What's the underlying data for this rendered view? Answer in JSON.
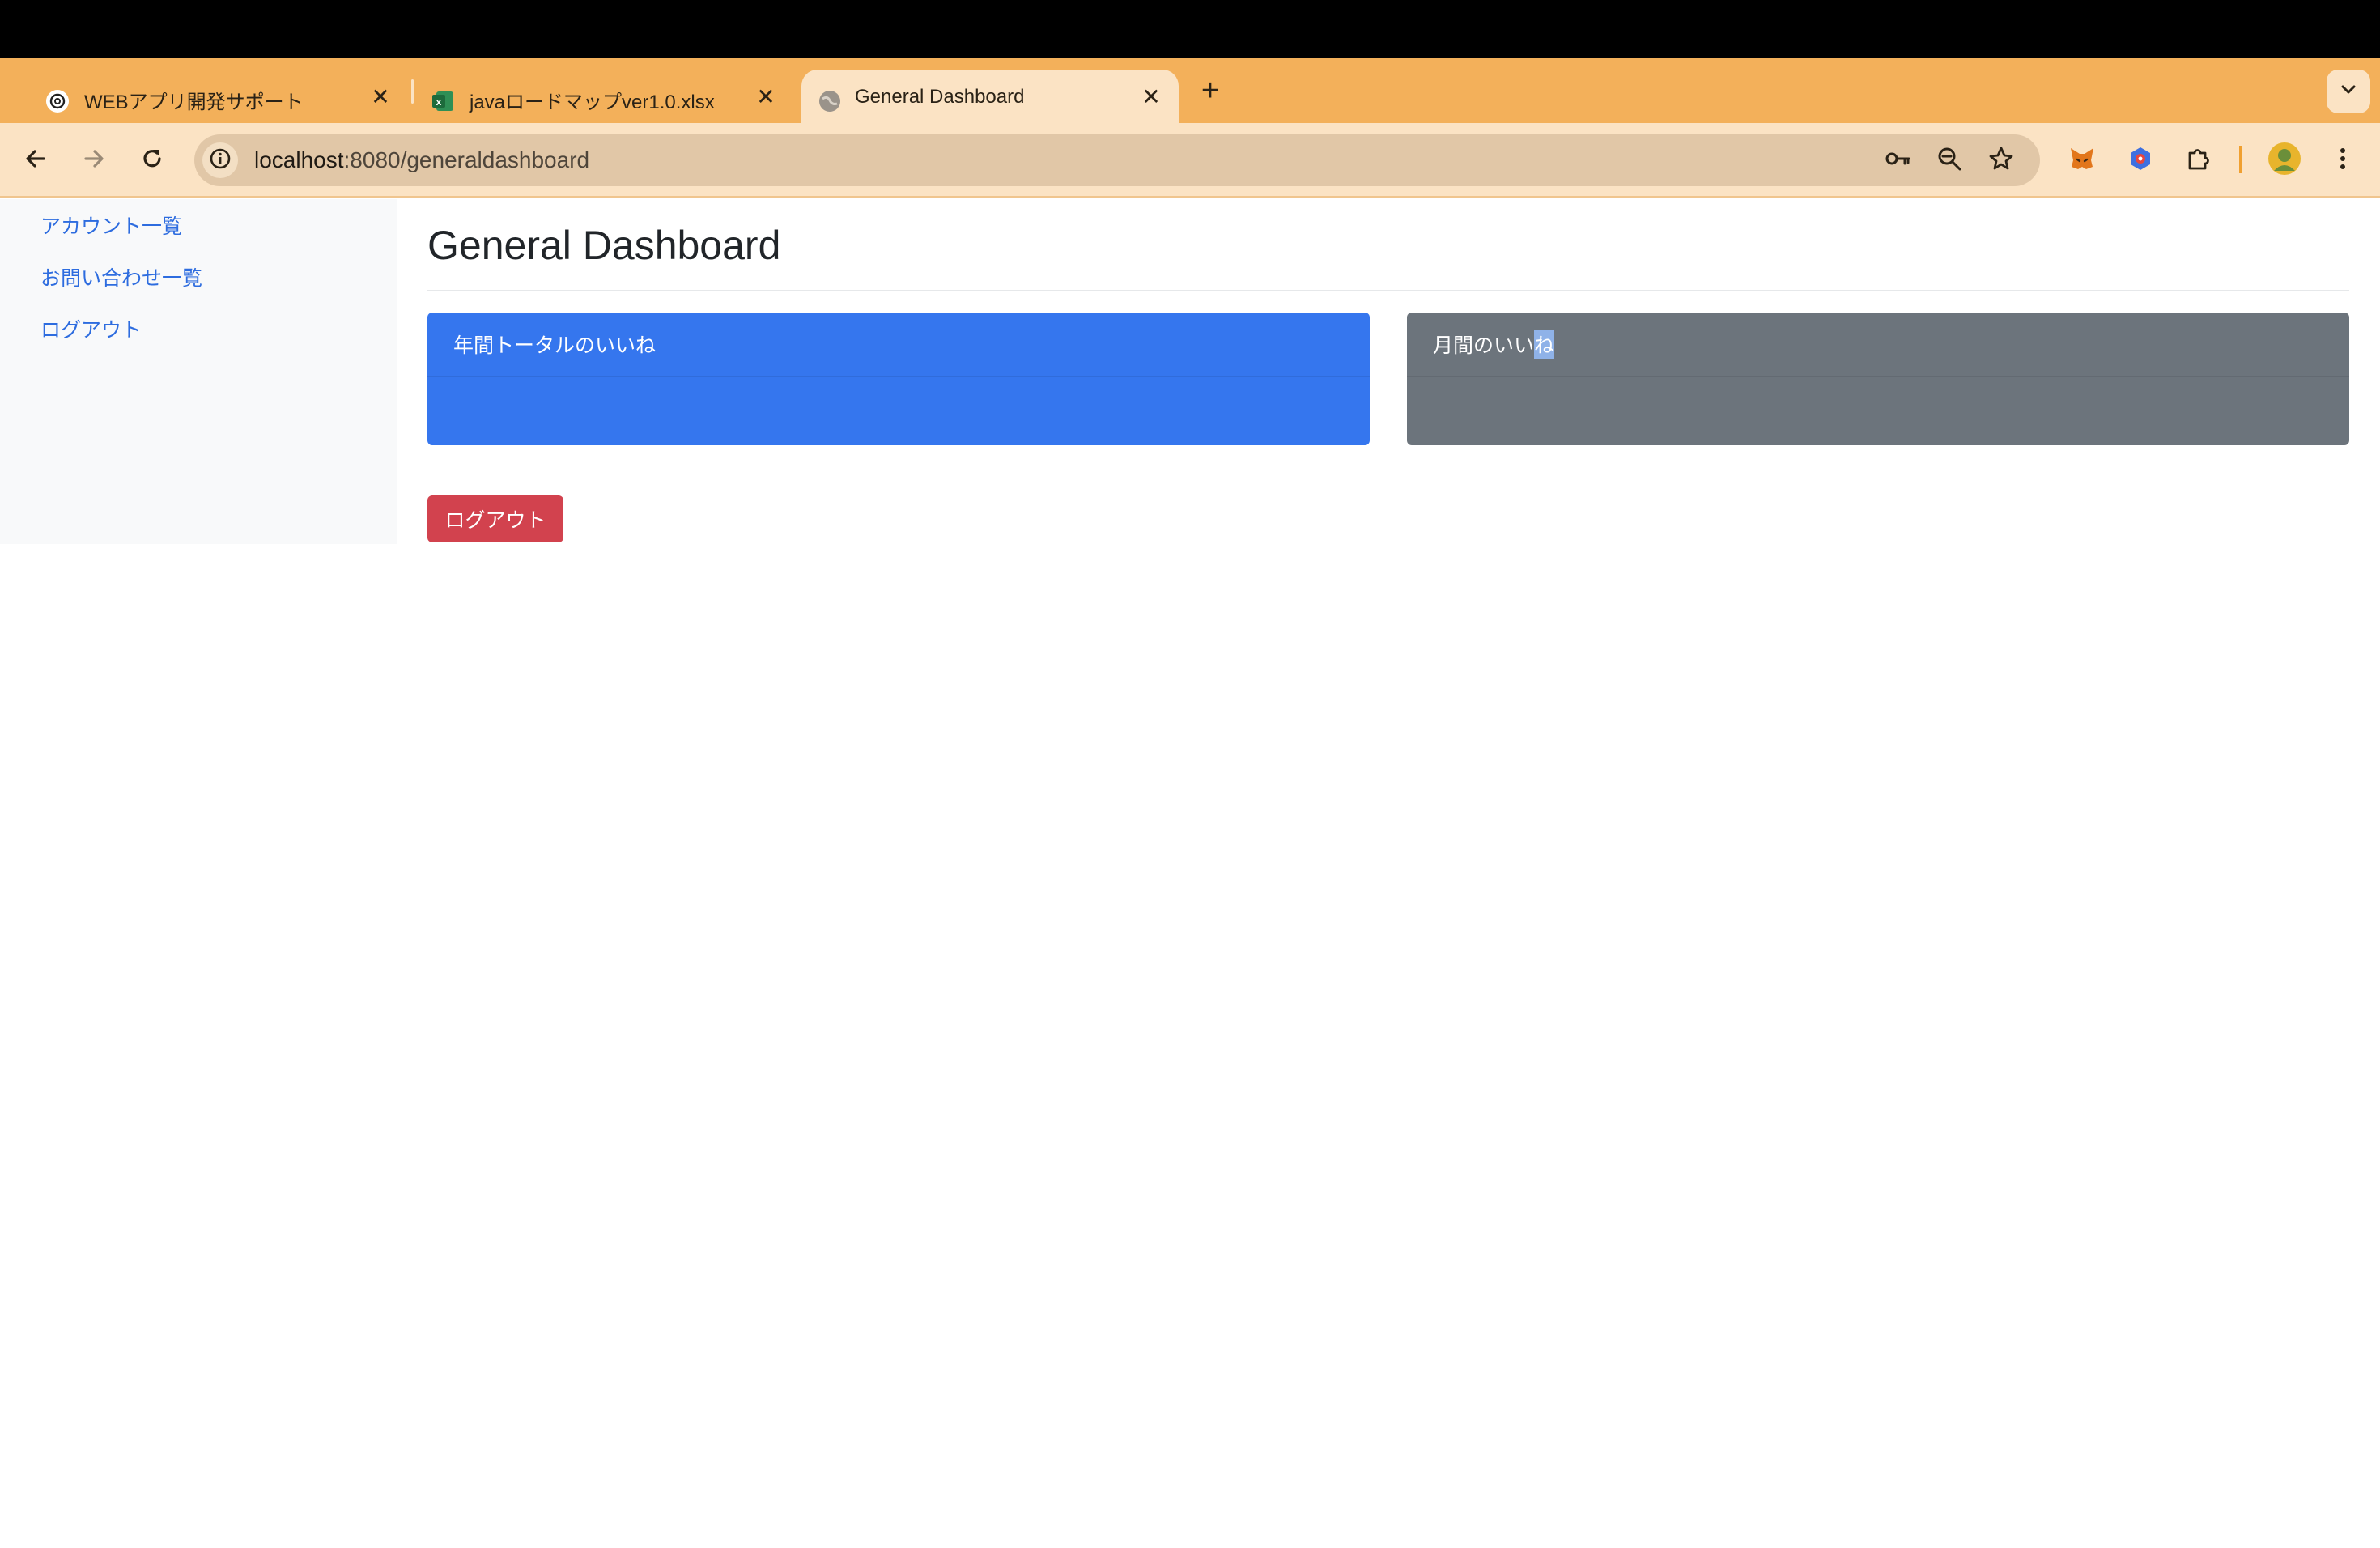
{
  "browser": {
    "tabs": [
      {
        "title": "WEBアプリ開発サポート",
        "icon": "openai-icon"
      },
      {
        "title": "javaロードマップver1.0.xlsx",
        "icon": "excel-icon"
      },
      {
        "title": "General Dashboard",
        "icon": "globe-icon",
        "active": true
      }
    ],
    "close_glyph": "✕",
    "new_tab_glyph": "+",
    "address": {
      "host": "localhost",
      "rest": ":8080/generaldashboard"
    }
  },
  "sidebar": {
    "links": [
      "アカウント一覧",
      "お問い合わせ一覧",
      "ログアウト"
    ]
  },
  "main": {
    "title": "General Dashboard",
    "cards": [
      {
        "header": "年間トータルのいいね",
        "color": "#3576ee"
      },
      {
        "header_prefix": "月間のいい",
        "header_selected": "ね",
        "color": "#6c747c"
      }
    ],
    "logout_button": "ログアウト",
    "logout_color": "#d2424e"
  }
}
